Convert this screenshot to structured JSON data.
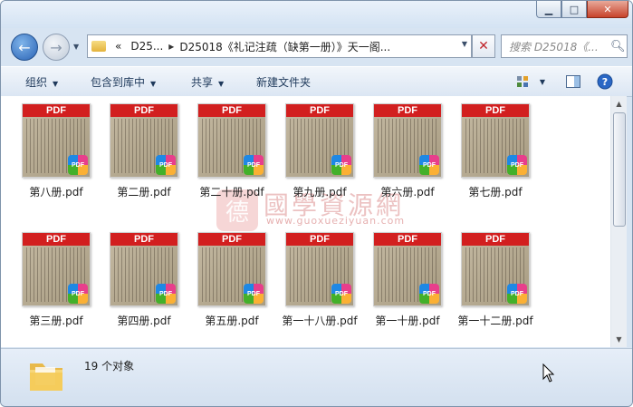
{
  "titlebar": {
    "buttons": {
      "minimize": "▁",
      "maximize": "□",
      "close": "✕"
    }
  },
  "nav": {
    "back_icon": "←",
    "forward_icon": "→",
    "address": {
      "overflow": "«",
      "crumb1": "D25...",
      "separator": "▸",
      "crumb2": "D25018《礼记注疏（缺第一册）》天一阁..."
    },
    "search_placeholder": "搜索 D25018《..."
  },
  "toolbar": {
    "organize": "组织",
    "include_library": "包含到库中",
    "share": "共享",
    "new_folder": "新建文件夹"
  },
  "files": [
    {
      "name": "第八册.pdf",
      "banner": "PDF",
      "badge": "PDF"
    },
    {
      "name": "第二册.pdf",
      "banner": "PDF",
      "badge": "PDF"
    },
    {
      "name": "第二十册.pdf",
      "banner": "PDF",
      "badge": "PDF"
    },
    {
      "name": "第九册.pdf",
      "banner": "PDF",
      "badge": "PDF"
    },
    {
      "name": "第六册.pdf",
      "banner": "PDF",
      "badge": "PDF"
    },
    {
      "name": "第七册.pdf",
      "banner": "PDF",
      "badge": "PDF"
    },
    {
      "name": "第三册.pdf",
      "banner": "PDF",
      "badge": "PDF"
    },
    {
      "name": "第四册.pdf",
      "banner": "PDF",
      "badge": "PDF"
    },
    {
      "name": "第五册.pdf",
      "banner": "PDF",
      "badge": "PDF"
    },
    {
      "name": "第一十八册.pdf",
      "banner": "PDF",
      "badge": "PDF"
    },
    {
      "name": "第一十册.pdf",
      "banner": "PDF",
      "badge": "PDF"
    },
    {
      "name": "第一十二册.pdf",
      "banner": "PDF",
      "badge": "PDF"
    }
  ],
  "watermark": {
    "seal": "德",
    "text": "國學資源網",
    "url": "www.guoxueziyuan.com"
  },
  "status": {
    "count_text": "19 个对象"
  },
  "colors": {
    "pdf_banner": "#d21f1f",
    "window_frame": "#d7e4f2",
    "toolbar_text": "#1e395b"
  }
}
